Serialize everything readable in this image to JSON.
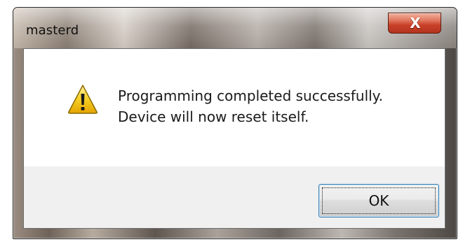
{
  "window": {
    "title": "masterd",
    "close_button_label": "X"
  },
  "message": {
    "icon": "warning-icon",
    "line1": "Programming completed successfully.",
    "line2": "Device will now reset itself."
  },
  "buttons": {
    "ok_label": "OK"
  },
  "colors": {
    "warning_yellow": "#f5c400",
    "close_red": "#c9402a",
    "button_border": "#3c7fb1"
  }
}
